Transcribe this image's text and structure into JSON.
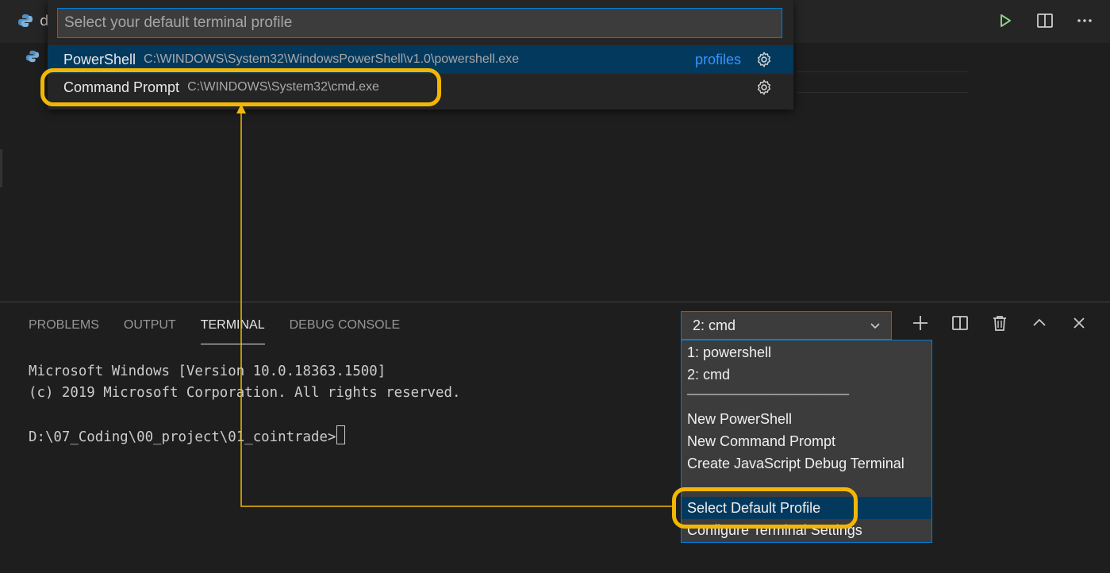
{
  "title_tab": {
    "label": "d"
  },
  "quick_pick": {
    "placeholder": "Select your default terminal profile",
    "items": [
      {
        "label": "PowerShell",
        "detail": "C:\\WINDOWS\\System32\\WindowsPowerShell\\v1.0\\powershell.exe",
        "link": "profiles",
        "selected": true
      },
      {
        "label": "Command Prompt",
        "detail": "C:\\WINDOWS\\System32\\cmd.exe",
        "selected": false
      }
    ]
  },
  "panel": {
    "tabs": [
      "PROBLEMS",
      "OUTPUT",
      "TERMINAL",
      "DEBUG CONSOLE"
    ],
    "active_tab": "TERMINAL",
    "terminal_select": {
      "value": "2: cmd"
    },
    "dropdown": {
      "items": [
        "1: powershell",
        "2: cmd",
        "──────────────────",
        "New PowerShell",
        "New Command Prompt",
        "Create JavaScript Debug Terminal",
        "",
        "Select Default Profile",
        "Configure Terminal Settings"
      ],
      "selected": "Select Default Profile"
    },
    "terminal_output": [
      "Microsoft Windows [Version 10.0.18363.1500]",
      "(c) 2019 Microsoft Corporation. All rights reserved.",
      "",
      "D:\\07_Coding\\00_project\\01_cointrade>"
    ]
  },
  "icons": {
    "editor_actions": [
      "run-icon",
      "split-editor-icon",
      "more-actions-icon"
    ],
    "panel_actions": [
      "new-terminal-icon",
      "split-terminal-icon",
      "kill-terminal-icon",
      "maximize-panel-icon",
      "close-panel-icon"
    ]
  },
  "colors": {
    "accent": "#007fd4",
    "highlight_annotation": "#f2b705",
    "selection": "#04395e",
    "link": "#3794ff",
    "run_green": "#89d185"
  }
}
